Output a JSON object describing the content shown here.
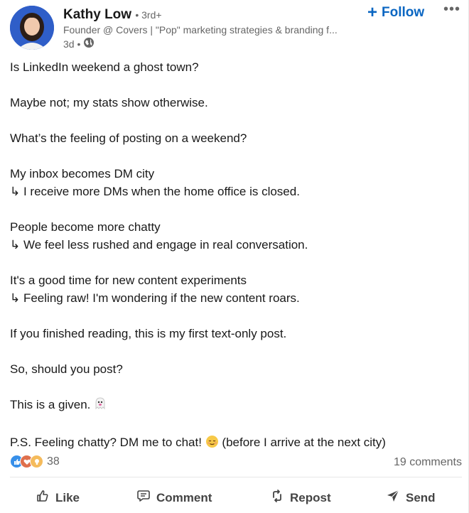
{
  "header": {
    "name": "Kathy Low",
    "degree": "• 3rd+",
    "headline": "Founder @ Covers | \"Pop\" marketing strategies & branding f...",
    "time": "3d •",
    "follow_label": "Follow",
    "visibility_icon": "globe-icon",
    "more_icon": "more-icon"
  },
  "post": {
    "lines": [
      "Is LinkedIn weekend a ghost town?",
      "Maybe not; my stats show otherwise.",
      "What’s the feeling of posting on a weekend?",
      "My inbox becomes DM city",
      "↳ I receive more DMs when the home office is closed.",
      "People become more chatty",
      "↳ We feel less rushed and engage in real conversation.",
      "It's a good time for new content experiments",
      "↳ Feeling raw! I'm wondering if the new content roars.",
      "If you finished reading, this is my first text-only post.",
      "So, should you post?",
      "This is a given.",
      "P.S. Feeling chatty? DM me to chat!",
      "(before I arrive at the next city)"
    ]
  },
  "social": {
    "reaction_count": "38",
    "comments_label": "19 comments",
    "reaction_icons": [
      "like-reaction-icon",
      "love-reaction-icon",
      "insightful-reaction-icon"
    ]
  },
  "actions": {
    "like": "Like",
    "comment": "Comment",
    "repost": "Repost",
    "send": "Send"
  },
  "colors": {
    "accent": "#0a66c2",
    "text": "#191919",
    "muted": "#666666"
  }
}
